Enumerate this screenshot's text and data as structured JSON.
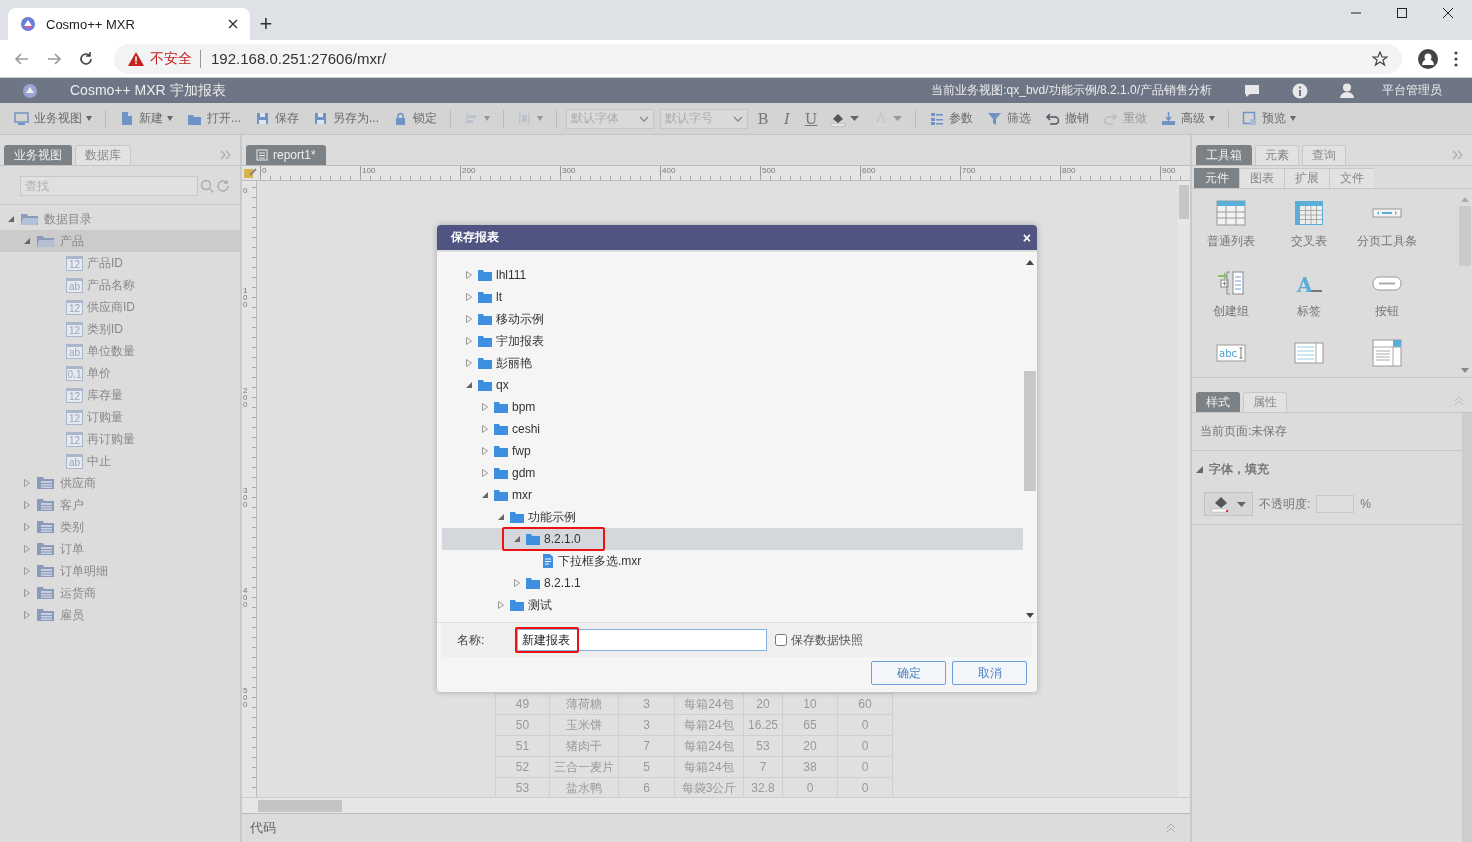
{
  "browser": {
    "tab_title": "Cosmo++ MXR",
    "new_tab": "+",
    "security": "不安全",
    "url": "192.168.0.251:27606/mxr/"
  },
  "app": {
    "title": "Cosmo++ MXR 宇加报表",
    "view_path": "当前业务视图:qx_bvd/功能示例/8.2.1.0/产品销售分析",
    "user": "平台管理员"
  },
  "toolbar": [
    {
      "kind": "button",
      "label": "业务视图",
      "dropdown": true,
      "disabled": false
    },
    {
      "kind": "separator"
    },
    {
      "kind": "button",
      "label": "新建",
      "dropdown": true,
      "disabled": false
    },
    {
      "kind": "button",
      "label": "打开...",
      "dropdown": false,
      "disabled": false
    },
    {
      "kind": "button",
      "label": "保存",
      "dropdown": false,
      "disabled": false
    },
    {
      "kind": "button",
      "label": "另存为...",
      "dropdown": false,
      "disabled": false
    },
    {
      "kind": "button",
      "label": "锁定",
      "dropdown": false,
      "disabled": false
    },
    {
      "kind": "separator"
    },
    {
      "kind": "button",
      "dropdown": true,
      "disabled": true
    },
    {
      "kind": "separator"
    },
    {
      "kind": "button",
      "dropdown": true,
      "disabled": true
    },
    {
      "kind": "separator"
    },
    {
      "kind": "select",
      "value": "默认字体"
    },
    {
      "kind": "select",
      "value": "默认字号"
    },
    {
      "kind": "format",
      "label": "B"
    },
    {
      "kind": "format",
      "label": "I"
    },
    {
      "kind": "format",
      "label": "U"
    },
    {
      "kind": "button",
      "dropdown": true,
      "disabled": false
    },
    {
      "kind": "button",
      "dropdown": true,
      "disabled": true
    },
    {
      "kind": "separator"
    },
    {
      "kind": "button",
      "label": "参数",
      "dropdown": false,
      "disabled": false
    },
    {
      "kind": "button",
      "label": "筛选",
      "dropdown": false,
      "disabled": false
    },
    {
      "kind": "button",
      "label": "撤销",
      "dropdown": false,
      "disabled": false
    },
    {
      "kind": "button",
      "label": "重做",
      "dropdown": false,
      "disabled": true
    },
    {
      "kind": "button",
      "label": "高级",
      "dropdown": true,
      "disabled": false
    },
    {
      "kind": "separator"
    },
    {
      "kind": "button",
      "label": "预览",
      "dropdown": true,
      "disabled": false
    }
  ],
  "left_panel": {
    "tabs": [
      {
        "label": "业务视图",
        "selected": true
      },
      {
        "label": "数据库",
        "selected": false
      }
    ],
    "search": {
      "placeholder": "查找"
    },
    "tree": [
      {
        "label": "数据目录",
        "kind": "catalog",
        "expanded": true,
        "selected": false,
        "children": [
          {
            "label": "产品",
            "kind": "table",
            "expanded": true,
            "selected": true,
            "children": [
              {
                "label": "产品ID",
                "kind": "field",
                "type_label": "12",
                "selected": false
              },
              {
                "label": "产品名称",
                "kind": "field",
                "type_label": "ab",
                "selected": false
              },
              {
                "label": "供应商ID",
                "kind": "field",
                "type_label": "12",
                "selected": false
              },
              {
                "label": "类别ID",
                "kind": "field",
                "type_label": "12",
                "selected": false
              },
              {
                "label": "单位数量",
                "kind": "field",
                "type_label": "ab",
                "selected": false
              },
              {
                "label": "单价",
                "kind": "field",
                "type_label": "0.1",
                "selected": false
              },
              {
                "label": "库存量",
                "kind": "field",
                "type_label": "12",
                "selected": false
              },
              {
                "label": "订购量",
                "kind": "field",
                "type_label": "12",
                "selected": false
              },
              {
                "label": "再订购量",
                "kind": "field",
                "type_label": "12",
                "selected": false
              },
              {
                "label": "中止",
                "kind": "field",
                "type_label": "ab",
                "selected": false
              }
            ]
          },
          {
            "label": "供应商",
            "kind": "table",
            "expanded": false,
            "selected": false
          },
          {
            "label": "客户",
            "kind": "table",
            "expanded": false,
            "selected": false
          },
          {
            "label": "类别",
            "kind": "table",
            "expanded": false,
            "selected": false
          },
          {
            "label": "订单",
            "kind": "table",
            "expanded": false,
            "selected": false
          },
          {
            "label": "订单明细",
            "kind": "table",
            "expanded": false,
            "selected": false
          },
          {
            "label": "运货商",
            "kind": "table",
            "expanded": false,
            "selected": false
          },
          {
            "label": "雇员",
            "kind": "table",
            "expanded": false,
            "selected": false
          }
        ]
      }
    ]
  },
  "editor": {
    "tabs": [
      {
        "label": "report1*",
        "selected": true
      }
    ],
    "h_ruler": [
      "0",
      "100",
      "200",
      "300",
      "400",
      "500",
      "600",
      "700",
      "800",
      "900"
    ],
    "v_ruler": [
      "0",
      "100",
      "200",
      "300",
      "400",
      "500"
    ],
    "table": {
      "rows": [
        [
          "49",
          "薄荷糖",
          "3",
          "每箱24包",
          "20",
          "10",
          "60"
        ],
        [
          "50",
          "玉米饼",
          "3",
          "每箱24包",
          "16.25",
          "65",
          "0"
        ],
        [
          "51",
          "猪肉干",
          "7",
          "每箱24包",
          "53",
          "20",
          "0"
        ],
        [
          "52",
          "三合一麦片",
          "5",
          "每箱24包",
          "7",
          "38",
          "0"
        ],
        [
          "53",
          "盐水鸭",
          "6",
          "每袋3公斤",
          "32.8",
          "0",
          "0"
        ]
      ]
    },
    "bottom_panel": {
      "title": "代码"
    }
  },
  "right_panel": {
    "tabs": [
      {
        "label": "工具箱",
        "selected": true
      },
      {
        "label": "元素",
        "selected": false
      },
      {
        "label": "查询",
        "selected": false
      }
    ],
    "subtabs": [
      {
        "label": "元件",
        "selected": true
      },
      {
        "label": "图表",
        "selected": false
      },
      {
        "label": "扩展",
        "selected": false
      },
      {
        "label": "文件",
        "selected": false
      }
    ],
    "tools": [
      {
        "kind": "list",
        "label": "普通列表"
      },
      {
        "kind": "crosstab",
        "label": "交叉表"
      },
      {
        "kind": "pager",
        "label": "分页工具条"
      },
      {
        "kind": "group",
        "label": "创建组"
      },
      {
        "kind": "label",
        "label": "标签",
        "glyph": "A"
      },
      {
        "kind": "button",
        "label": "按钮"
      },
      {
        "kind": "textbox",
        "glyph": "abc"
      },
      {
        "kind": "textarea"
      },
      {
        "kind": "dropdown"
      }
    ],
    "style_tabs": [
      {
        "label": "样式",
        "selected": true
      },
      {
        "label": "属性",
        "selected": false
      }
    ],
    "page_status": "当前页面:未保存",
    "section": {
      "title": "字体，填充",
      "expanded": true
    },
    "opacity_label": "不透明度:",
    "unit": "%"
  },
  "dialog": {
    "title": "保存报表",
    "close": "×",
    "tree": [
      {
        "label": "lhl111",
        "kind": "folder",
        "expanded": false,
        "selected": false
      },
      {
        "label": "lt",
        "kind": "folder",
        "expanded": false,
        "selected": false
      },
      {
        "label": "移动示例",
        "kind": "folder",
        "expanded": false,
        "selected": false
      },
      {
        "label": "宇加报表",
        "kind": "folder",
        "expanded": false,
        "selected": false
      },
      {
        "label": "彭丽艳",
        "kind": "folder",
        "expanded": false,
        "selected": false
      },
      {
        "label": "qx",
        "kind": "folder",
        "expanded": true,
        "selected": false,
        "children": [
          {
            "label": "bpm",
            "kind": "folder",
            "expanded": false,
            "selected": false
          },
          {
            "label": "ceshi",
            "kind": "folder",
            "expanded": false,
            "selected": false
          },
          {
            "label": "fwp",
            "kind": "folder",
            "expanded": false,
            "selected": false
          },
          {
            "label": "gdm",
            "kind": "folder",
            "expanded": false,
            "selected": false
          },
          {
            "label": "mxr",
            "kind": "folder",
            "expanded": true,
            "selected": false,
            "children": [
              {
                "label": "功能示例",
                "kind": "folder",
                "expanded": true,
                "selected": false,
                "children": [
                  {
                    "label": "8.2.1.0",
                    "kind": "folder",
                    "expanded": true,
                    "selected": true,
                    "annotated": true,
                    "children": [
                      {
                        "label": "下拉框多选.mxr",
                        "kind": "file",
                        "selected": false
                      }
                    ]
                  },
                  {
                    "label": "8.2.1.1",
                    "kind": "folder",
                    "expanded": false,
                    "selected": false
                  }
                ]
              },
              {
                "label": "测试",
                "kind": "folder",
                "expanded": false,
                "selected": false
              }
            ]
          }
        ]
      }
    ],
    "name_label": "名称:",
    "name_value": "新建报表",
    "name_annotated": true,
    "snapshot": {
      "label": "保存数据快照",
      "checked": false
    },
    "buttons": [
      "确定",
      "取消"
    ]
  }
}
